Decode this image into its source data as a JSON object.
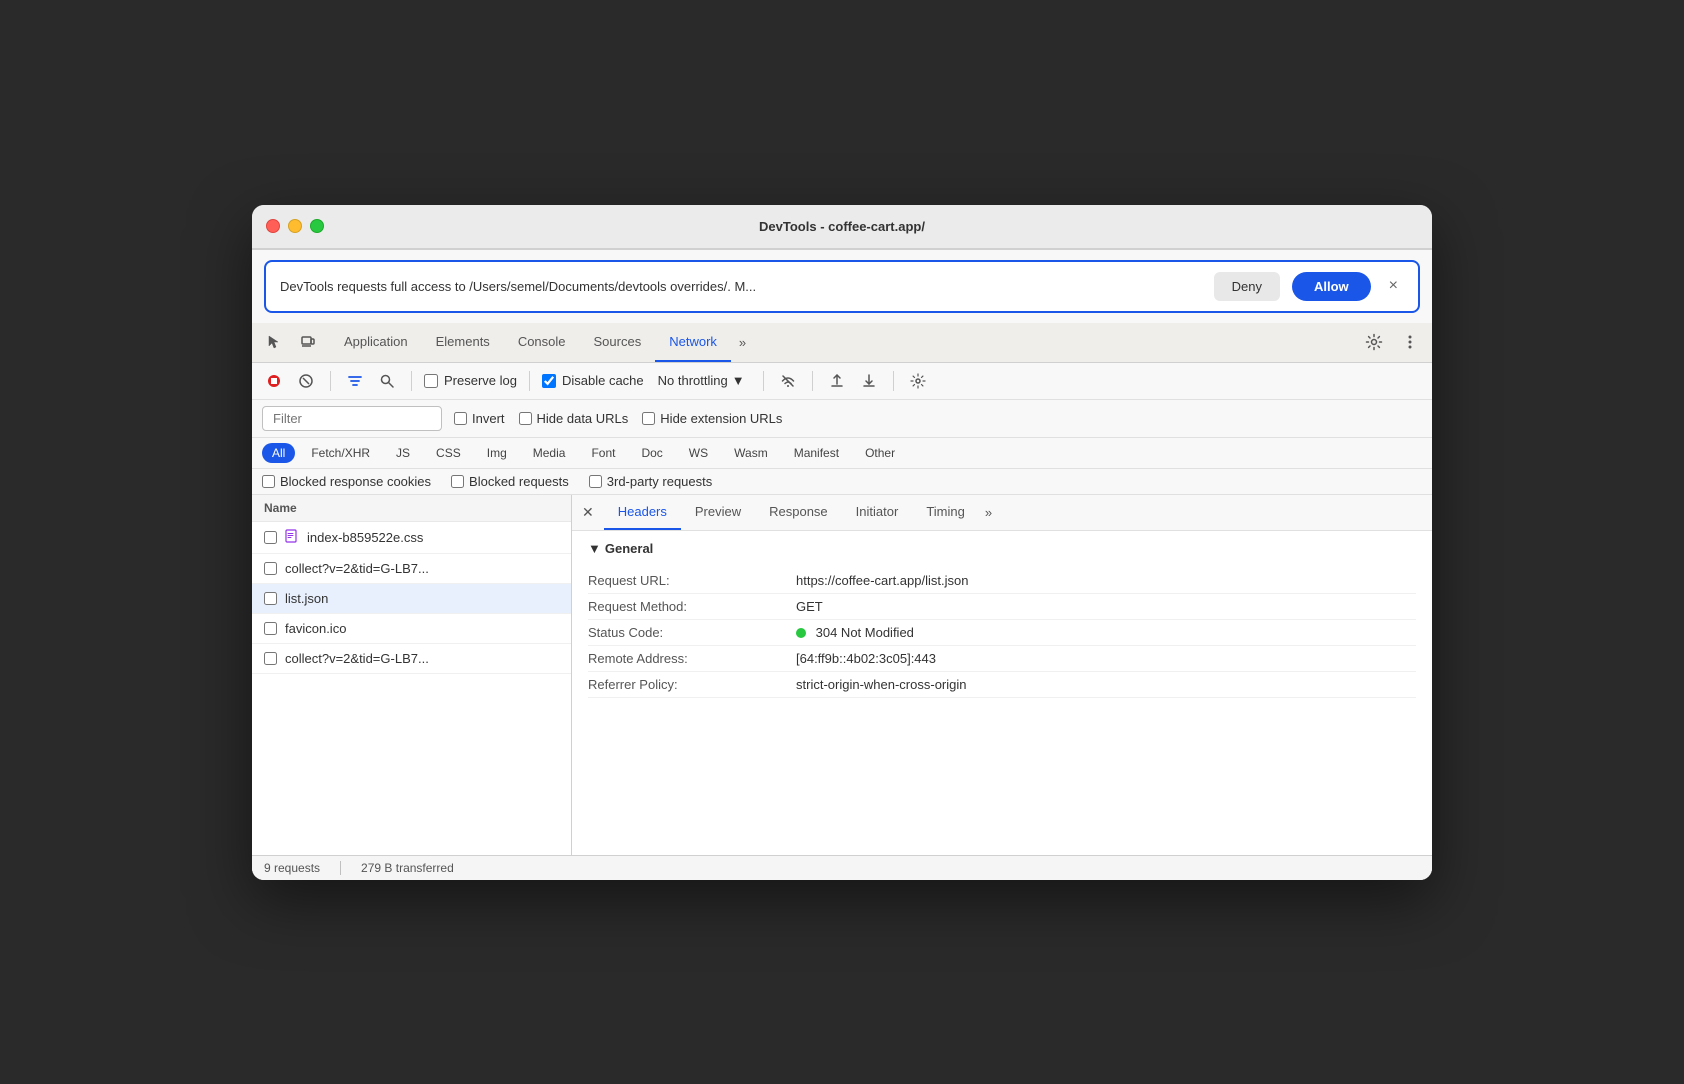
{
  "window": {
    "title": "DevTools - coffee-cart.app/"
  },
  "permission": {
    "text": "DevTools requests full access to /Users/semel/Documents/devtools overrides/. M...",
    "deny_label": "Deny",
    "allow_label": "Allow",
    "close_label": "×"
  },
  "tabs": {
    "items": [
      {
        "label": "Application",
        "active": false
      },
      {
        "label": "Elements",
        "active": false
      },
      {
        "label": "Console",
        "active": false
      },
      {
        "label": "Sources",
        "active": false
      },
      {
        "label": "Network",
        "active": true
      }
    ],
    "overflow": "»"
  },
  "toolbar": {
    "preserve_log_label": "Preserve log",
    "disable_cache_label": "Disable cache",
    "throttle_label": "No throttling",
    "throttle_arrow": "▼"
  },
  "filter": {
    "placeholder": "Filter",
    "invert_label": "Invert",
    "hide_data_urls_label": "Hide data URLs",
    "hide_extension_urls_label": "Hide extension URLs"
  },
  "type_filters": [
    {
      "label": "All",
      "active": true
    },
    {
      "label": "Fetch/XHR",
      "active": false
    },
    {
      "label": "JS",
      "active": false
    },
    {
      "label": "CSS",
      "active": false
    },
    {
      "label": "Img",
      "active": false
    },
    {
      "label": "Media",
      "active": false
    },
    {
      "label": "Font",
      "active": false
    },
    {
      "label": "Doc",
      "active": false
    },
    {
      "label": "WS",
      "active": false
    },
    {
      "label": "Wasm",
      "active": false
    },
    {
      "label": "Manifest",
      "active": false
    },
    {
      "label": "Other",
      "active": false
    }
  ],
  "extra_filters": {
    "blocked_cookies_label": "Blocked response cookies",
    "blocked_requests_label": "Blocked requests",
    "third_party_label": "3rd-party requests"
  },
  "file_list": {
    "header": "Name",
    "items": [
      {
        "name": "index-b859522e.css",
        "is_css": true,
        "selected": false
      },
      {
        "name": "collect?v=2&tid=G-LB7...",
        "is_css": false,
        "selected": false
      },
      {
        "name": "list.json",
        "is_css": false,
        "selected": true
      },
      {
        "name": "favicon.ico",
        "is_css": false,
        "selected": false
      },
      {
        "name": "collect?v=2&tid=G-LB7...",
        "is_css": false,
        "selected": false
      }
    ]
  },
  "detail": {
    "tabs": [
      "Headers",
      "Preview",
      "Response",
      "Initiator",
      "Timing"
    ],
    "active_tab": "Headers",
    "overflow": "»",
    "section_title": "▼ General",
    "headers": [
      {
        "key": "Request URL:",
        "value": "https://coffee-cart.app/list.json"
      },
      {
        "key": "Request Method:",
        "value": "GET"
      },
      {
        "key": "Status Code:",
        "value": "304 Not Modified",
        "has_dot": true
      },
      {
        "key": "Remote Address:",
        "value": "[64:ff9b::4b02:3c05]:443"
      },
      {
        "key": "Referrer Policy:",
        "value": "strict-origin-when-cross-origin"
      }
    ]
  },
  "status_bar": {
    "requests": "9 requests",
    "transferred": "279 B transferred"
  },
  "icons": {
    "cursor": "⌖",
    "device": "⬜",
    "stop": "⏺",
    "clear": "⊘",
    "filter": "▼",
    "search": "🔍",
    "upload": "↑",
    "download": "↓",
    "gear": "⚙",
    "more": "⋮",
    "wifi": "⌇",
    "settings": "⚙"
  },
  "colors": {
    "active_tab": "#1a56e8",
    "allow_btn": "#1a56e8",
    "permission_border": "#1a56e8",
    "status_green": "#28c840",
    "css_icon": "#9333ea"
  }
}
